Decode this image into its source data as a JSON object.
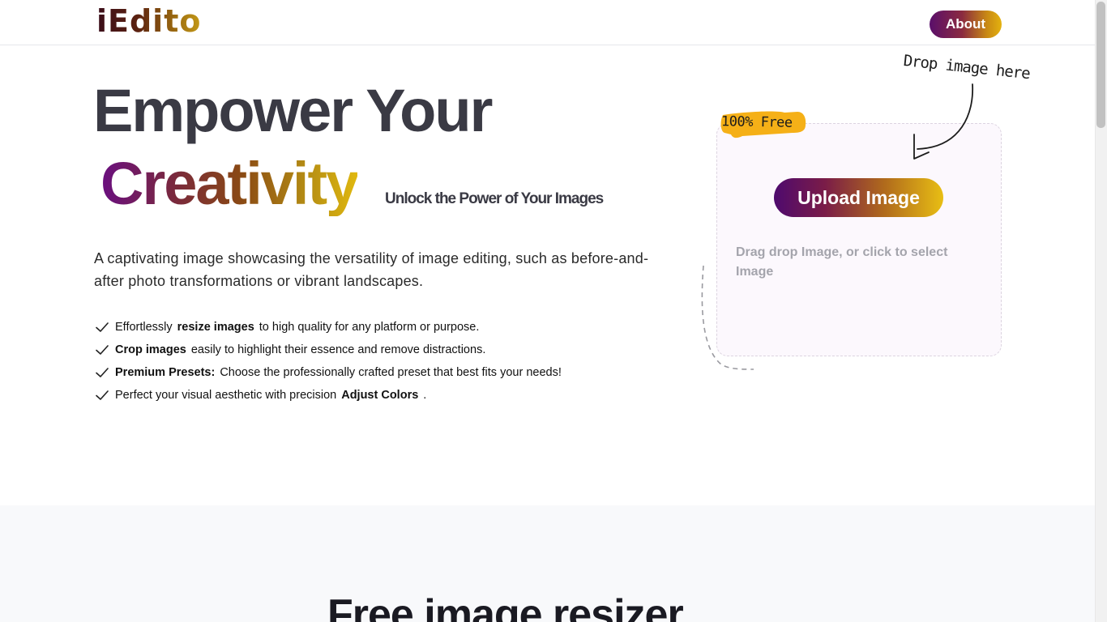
{
  "header": {
    "logo": "iEdito",
    "about_label": "About"
  },
  "hero": {
    "title_line1": "Empower Your",
    "title_line2": "Creativity",
    "subtitle": "Unlock the Power of Your Images",
    "description": "A captivating image showcasing the versatility of image editing, such as before-and-after photo transformations or vibrant landscapes.",
    "features": [
      {
        "before": "Effortlessly",
        "bold": "resize images",
        "after": "to high quality for any platform or purpose."
      },
      {
        "before": "",
        "bold": "Crop images",
        "after": "easily to highlight their essence and remove distractions."
      },
      {
        "before": "",
        "bold": "Premium Presets:",
        "after": "Choose the professionally crafted preset that best fits your needs!"
      },
      {
        "before": "Perfect your visual aesthetic with precision",
        "bold": "Adjust Colors",
        "after": "."
      }
    ]
  },
  "upload": {
    "badge": "100% Free",
    "hint": "Drop image here",
    "button_label": "Upload Image",
    "drag_text": "Drag drop Image, or click to select Image"
  },
  "lower": {
    "title": "Free image resizer"
  },
  "colors": {
    "gradient_start": "#5a0f6b",
    "gradient_end": "#e4b20f",
    "badge": "#f5b017"
  }
}
